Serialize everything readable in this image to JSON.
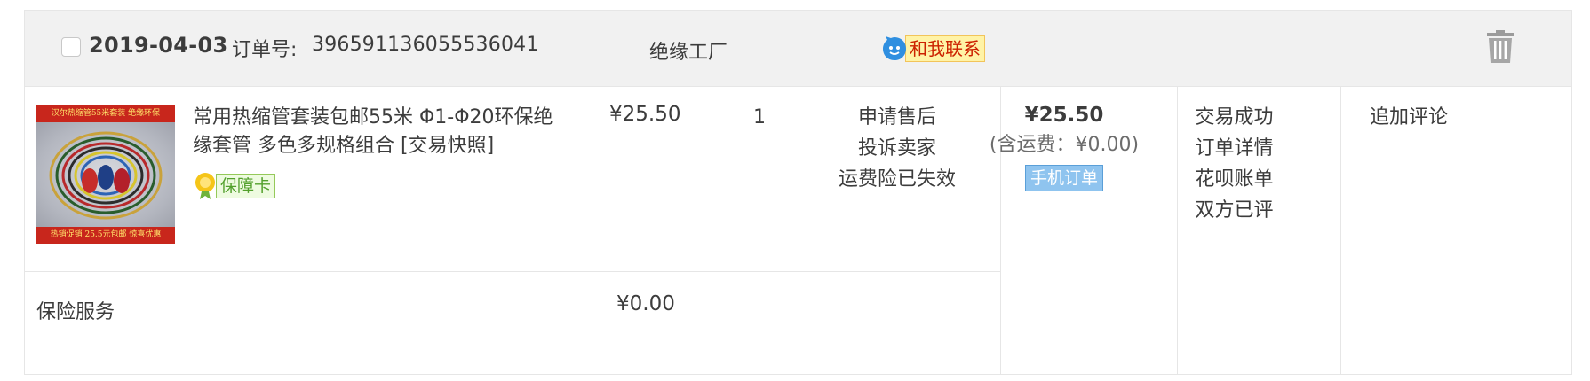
{
  "order": {
    "date": "2019-04-03",
    "order_no_label": "订单号:",
    "order_no": "396591136055536041",
    "shop_name": "绝缘工厂",
    "contact_label": "和我联系"
  },
  "item": {
    "thumb_top_text": "汉尔热缩管55米套装 绝缘环保",
    "thumb_bottom_text": "热销促销 25.5元包邮 惊喜优惠",
    "title_line1": "常用热缩管套装包邮55米 Φ1-Φ20环保绝",
    "title_line2": "缘套管 多色多规格组合",
    "snapshot_link": "[交易快照]",
    "badge_label": "保障卡",
    "unit_price": "¥25.50",
    "quantity": "1",
    "actions": [
      "申请售后",
      "投诉卖家",
      "运费险已失效"
    ]
  },
  "totals": {
    "total": "¥25.50",
    "shipping": "(含运费：¥0.00)",
    "mobile_tag": "手机订单"
  },
  "status": {
    "items": [
      "交易成功",
      "订单详情",
      "花呗账单",
      "双方已评"
    ]
  },
  "extra": {
    "label": "追加评论"
  },
  "insurance": {
    "label": "保险服务",
    "price": "¥0.00"
  },
  "icons": {
    "contact": "chat-bubble-icon",
    "trash": "trash-icon",
    "badge": "flower-badge-icon"
  },
  "colors": {
    "header_bg": "#f1f1f1",
    "border": "#e6e6e6",
    "contact_text": "#cc2200",
    "badge_green": "#52a02c",
    "mobile_tag_bg": "#8fc4ef"
  }
}
